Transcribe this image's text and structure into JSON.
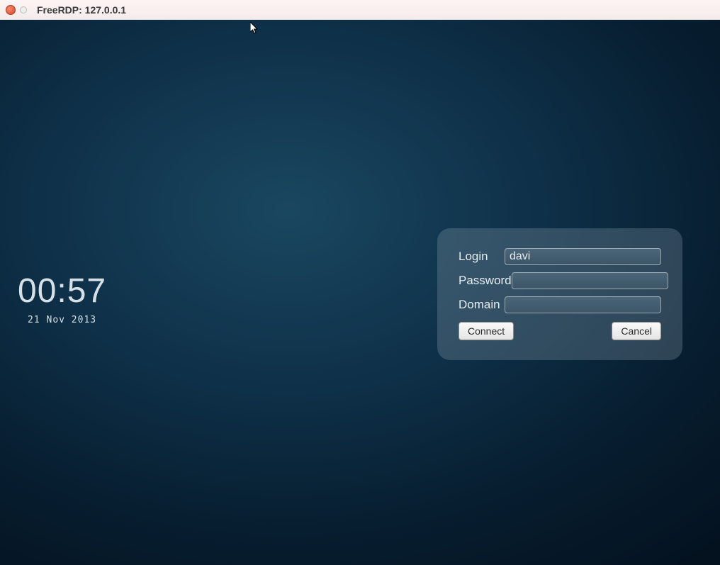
{
  "window": {
    "title": "FreeRDP: 127.0.0.1"
  },
  "clock": {
    "time": "00:57",
    "date": "21 Nov 2013"
  },
  "login": {
    "login_label": "Login",
    "login_value": "davi",
    "password_label": "Password",
    "password_value": "",
    "domain_label": "Domain",
    "domain_value": "",
    "connect_label": "Connect",
    "cancel_label": "Cancel"
  }
}
